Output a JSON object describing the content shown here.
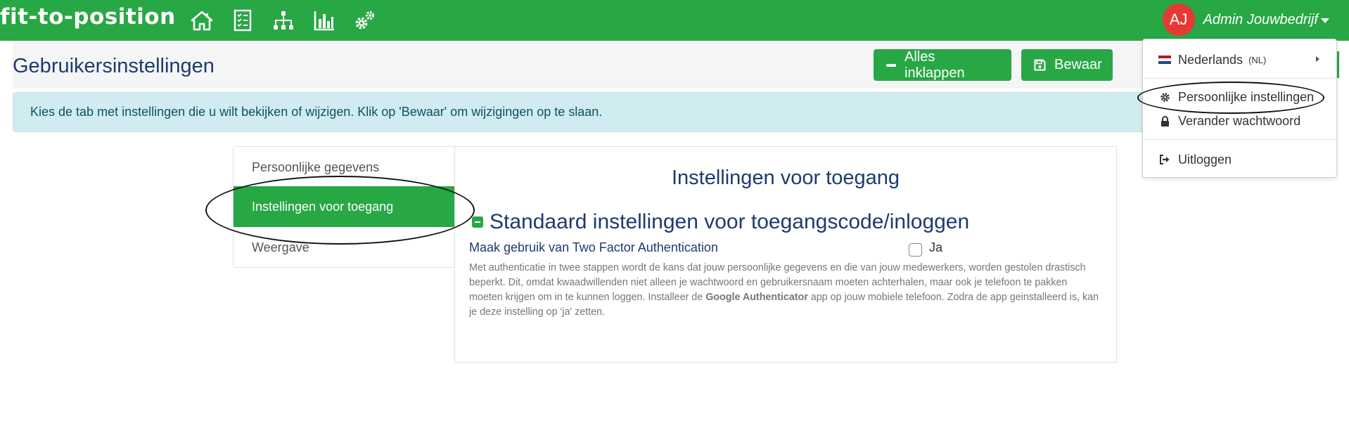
{
  "navbar": {
    "logo": "fit-to-position",
    "icons": [
      "home-icon",
      "checklist-icon",
      "org-chart-icon",
      "bar-chart-icon",
      "cogs-icon"
    ],
    "user": {
      "initials": "AJ",
      "name": "Admin Jouwbedrijf"
    }
  },
  "header": {
    "title": "Gebruikersinstellingen",
    "collapse_button": "Alles inklappen",
    "save_button": "Bewaar"
  },
  "alert": {
    "text": "Kies de tab met instellingen die u wilt bekijken of wijzigen. Klik op 'Bewaar' om wijzigingen op te slaan."
  },
  "tabs": [
    {
      "label": "Persoonlijke gegevens",
      "active": false
    },
    {
      "label": "Instellingen voor toegang",
      "active": true
    },
    {
      "label": "Weergave",
      "active": false
    }
  ],
  "content": {
    "title": "Instellingen voor toegang",
    "section_title": "Standaard instellingen voor toegangscode/inloggen",
    "setting_label": "Maak gebruik van Two Factor Authentication",
    "checkbox_label": "Ja",
    "checkbox_checked": false,
    "help_before": "Met authenticatie in twee stappen wordt de kans dat jouw persoonlijke gegevens en die van jouw medewerkers, worden gestolen drastisch beperkt. Dit, omdat kwaadwillenden niet alleen je wachtwoord en gebruikersnaam moeten achterhalen, maar ook je telefoon te pakken moeten krijgen om in te kunnen loggen. Installeer de ",
    "help_bold": "Google Authenticator",
    "help_after": " app op jouw mobiele telefoon. Zodra de app geinstalleerd is, kan je deze instelling op 'ja' zetten."
  },
  "dropdown": {
    "language": "Nederlands",
    "language_code": "(NL)",
    "personal_settings": "Persoonlijke instellingen",
    "change_password": "Verander wachtwoord",
    "logout": "Uitloggen"
  },
  "colors": {
    "brand_green": "#28a745",
    "title_navy": "#1d3b6e",
    "avatar_red": "#e53935",
    "alert_bg": "#d1ecf1"
  }
}
